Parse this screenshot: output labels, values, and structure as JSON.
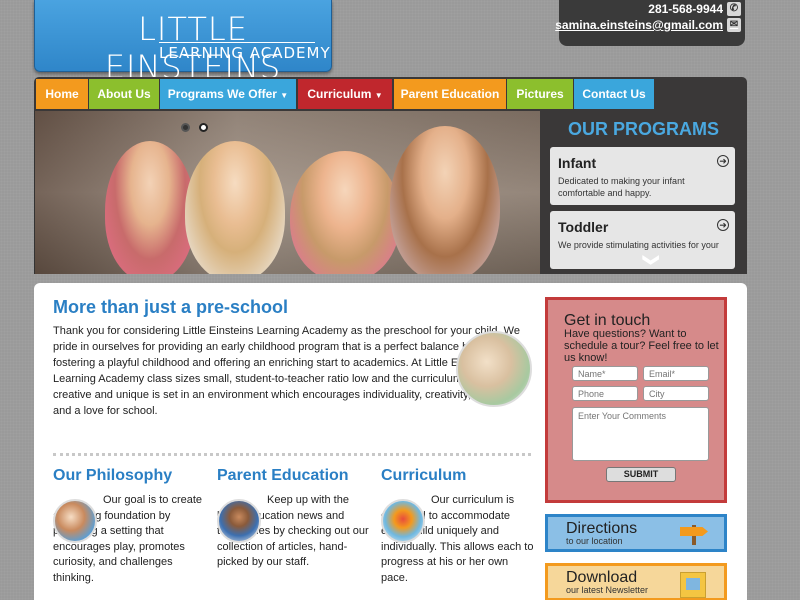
{
  "logo": {
    "line1": "LITTLE EINSTEINS",
    "line2": "LEARNING ACADEMY"
  },
  "contact": {
    "phone": "281-568-9944",
    "email": "samina.einsteins@gmail.com"
  },
  "nav": [
    {
      "label": "Home",
      "color": "#f39a1e"
    },
    {
      "label": "About Us",
      "color": "#8cbf2d"
    },
    {
      "label": "Programs We Offer",
      "color": "#3aa6dc",
      "dropdown": true
    },
    {
      "label": "Curriculum",
      "color": "#c0272d",
      "dropdown": true
    },
    {
      "label": "Parent Education",
      "color": "#f39a1e"
    },
    {
      "label": "Pictures",
      "color": "#8cbf2d"
    },
    {
      "label": "Contact Us",
      "color": "#3aa6dc"
    }
  ],
  "programs": {
    "heading": "OUR PROGRAMS",
    "items": [
      {
        "title": "Infant",
        "desc": "Dedicated to making your infant comfortable and happy."
      },
      {
        "title": "Toddler",
        "desc": "We provide stimulating activities for your"
      }
    ]
  },
  "main": {
    "heading": "More than just a pre-school",
    "intro": "Thank you for considering Little Einsteins Learning Academy as the preschool for your child. We pride in ourselves for providing an early childhood program that is a perfect balance between fostering a playful childhood and offering an enriching start to academics. At Little Einsteins Learning Academy class sizes small, student-to-teacher ratio low and the curriculum challenging, creative and unique is set in an environment which encourages individuality, creativity, success and a love for school.",
    "columns": [
      {
        "heading": "Our Philosophy",
        "text": "Our goal is to create a learning foundation by providing a setting that encourages play, promotes curiosity, and challenges thinking."
      },
      {
        "heading": "Parent Education",
        "text": "Keep up with the latest education news and techniques by checking out our collection of articles, hand-picked by our staff."
      },
      {
        "heading": "Curriculum",
        "text": "Our curriculum is designed to accommodate every child uniquely and individually. This allows each to progress at his or her own pace."
      }
    ]
  },
  "touch": {
    "heading": "Get in touch",
    "text": "Have questions? Want to schedule a tour? Feel free to let us know!",
    "name_ph": "Name*",
    "email_ph": "Email*",
    "phone_ph": "Phone",
    "city_ph": "City",
    "comments_ph": "Enter Your Comments",
    "submit": "SUBMIT"
  },
  "directions": {
    "big": "Directions",
    "small": "to our location"
  },
  "download": {
    "big": "Download",
    "small": "our latest Newsletter"
  },
  "slider": {
    "chevron": "❯"
  }
}
